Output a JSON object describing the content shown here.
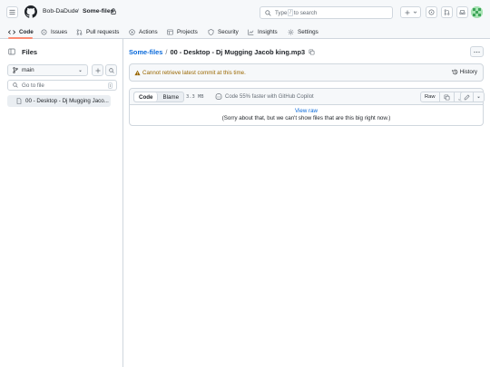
{
  "header": {
    "owner": "Bob-DaDude",
    "separator": "/",
    "repo": "Some-files",
    "search_placeholder": "Type",
    "search_key": "/",
    "search_suffix": "to search"
  },
  "nav": {
    "items": [
      {
        "label": "Code",
        "icon": "code-icon"
      },
      {
        "label": "Issues",
        "icon": "issue-icon"
      },
      {
        "label": "Pull requests",
        "icon": "pull-request-icon"
      },
      {
        "label": "Actions",
        "icon": "play-icon"
      },
      {
        "label": "Projects",
        "icon": "table-icon"
      },
      {
        "label": "Security",
        "icon": "shield-icon"
      },
      {
        "label": "Insights",
        "icon": "graph-icon"
      },
      {
        "label": "Settings",
        "icon": "gear-icon"
      }
    ]
  },
  "sidebar": {
    "title": "Files",
    "branch": "main",
    "go_to_file": "Go to file",
    "go_to_file_key": "t",
    "files": [
      {
        "name": "00 - Desktop - Dj Mugging Jaco..."
      }
    ]
  },
  "main": {
    "breadcrumb_repo": "Some-files",
    "breadcrumb_sep": "/",
    "file_name": "00 - Desktop - Dj Mugging Jacob king.mp3",
    "warning": "Cannot retrieve latest commit at this time.",
    "history_label": "History",
    "tab_code": "Code",
    "tab_blame": "Blame",
    "file_size": "3.3 MB",
    "copilot_text": "Code 55% faster with GitHub Copilot",
    "raw_label": "Raw",
    "view_raw": "View raw",
    "too_big_message": "(Sorry about that, but we can't show files that are this big right now.)"
  },
  "colors": {
    "accent_link": "#0969da",
    "nav_underline": "#fd8c73",
    "warning_text": "#9a6700",
    "border": "#d0d7de",
    "header_bg": "#f6f8fa"
  }
}
